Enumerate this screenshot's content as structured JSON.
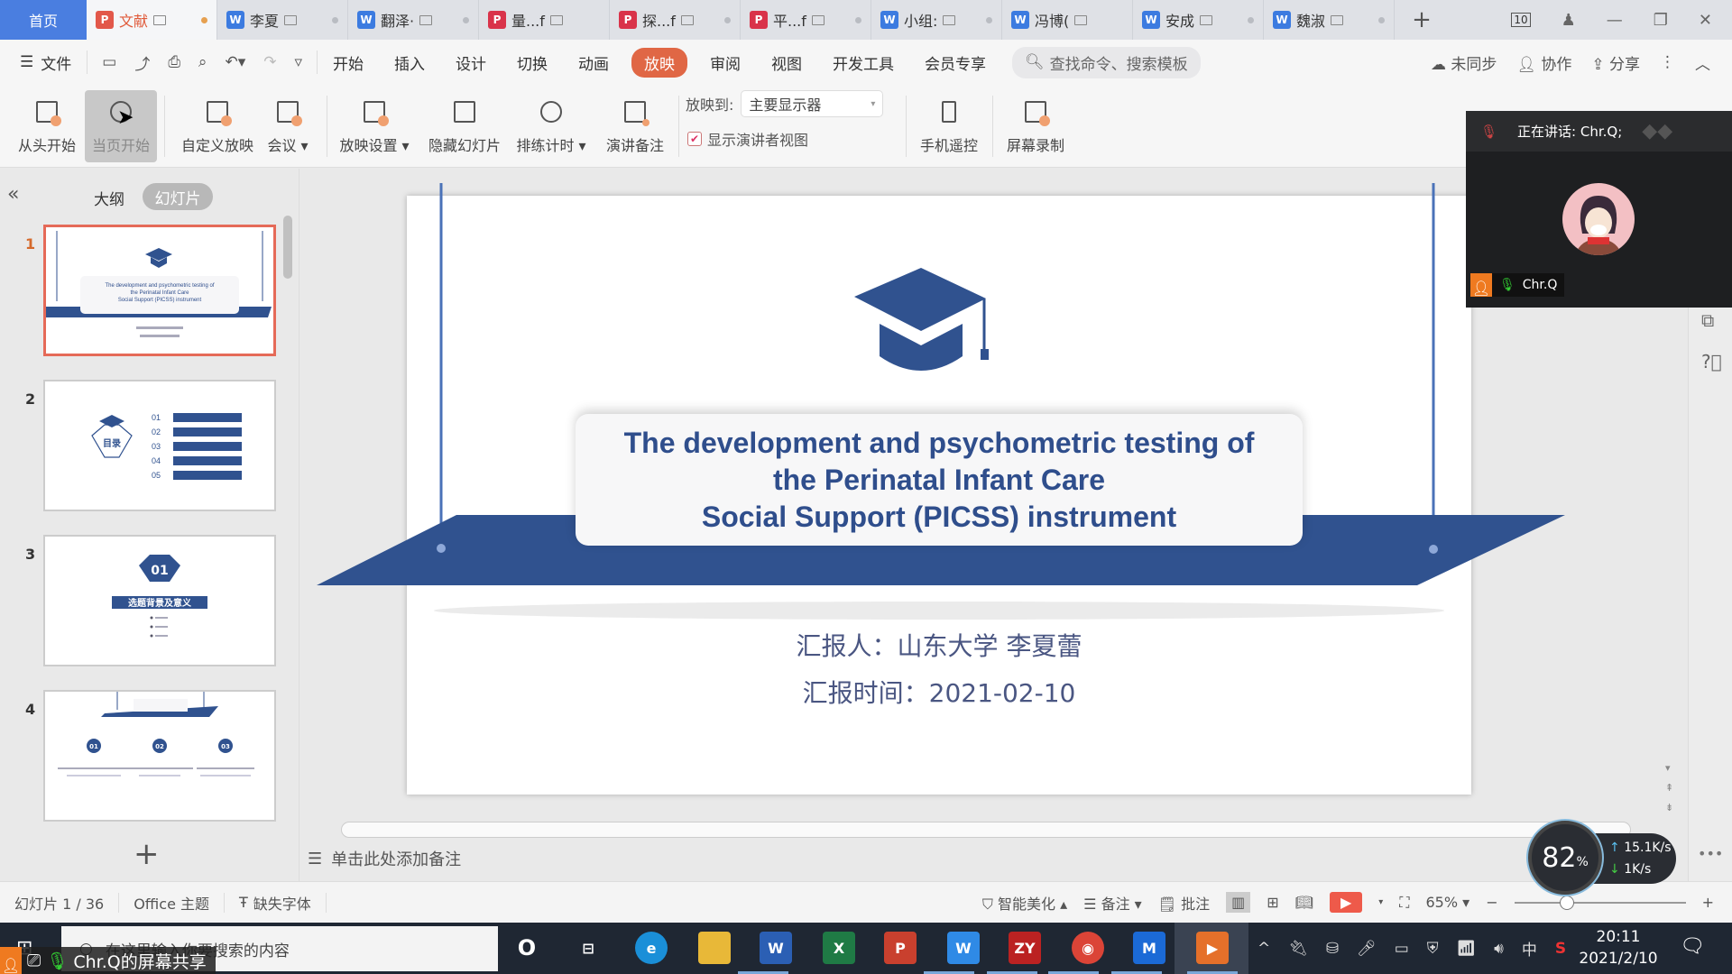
{
  "tabbar": {
    "home": "首页",
    "tabs": [
      {
        "label": "文献",
        "type": "p",
        "active": true
      },
      {
        "label": "李夏",
        "type": "w"
      },
      {
        "label": "翻泽·",
        "type": "w"
      },
      {
        "label": "量...f",
        "type": "r"
      },
      {
        "label": "探...f",
        "type": "r"
      },
      {
        "label": "平...f",
        "type": "r"
      },
      {
        "label": "小组:",
        "type": "w"
      },
      {
        "label": "冯博(",
        "type": "w"
      },
      {
        "label": "安成",
        "type": "w"
      },
      {
        "label": "魏淑",
        "type": "w"
      }
    ],
    "add_tab": "+",
    "badge_box": "10",
    "minimize": "—",
    "restore": "❐",
    "close": "✕"
  },
  "menubar": {
    "file": "文件",
    "items": [
      "开始",
      "插入",
      "设计",
      "切换",
      "动画",
      "放映",
      "审阅",
      "视图",
      "开发工具",
      "会员专享"
    ],
    "active": "放映",
    "search_placeholder": "查找命令、搜索模板",
    "right": {
      "sync": "未同步",
      "collab": "协作",
      "share": "分享"
    }
  },
  "ribbon": {
    "buttons": [
      {
        "label": "从头开始"
      },
      {
        "label": "当页开始"
      },
      {
        "label": "自定义放映"
      },
      {
        "label": "会议 ▾"
      },
      {
        "label": "放映设置 ▾"
      },
      {
        "label": "隐藏幻灯片"
      },
      {
        "label": "排练计时 ▾"
      },
      {
        "label": "演讲备注"
      },
      {
        "label": "手机遥控"
      },
      {
        "label": "屏幕录制"
      }
    ],
    "cast_to_label": "放映到:",
    "cast_to_value": "主要显示器",
    "presenter_view_label": "显示演讲者视图",
    "presenter_view_checked": true
  },
  "leftpanel": {
    "outline_tab": "大纲",
    "slides_tab": "幻灯片",
    "thumbnails": [
      {
        "num": "1",
        "selected": true
      },
      {
        "num": "2"
      },
      {
        "num": "3"
      },
      {
        "num": "4"
      }
    ],
    "thumb2": {
      "title": "目录",
      "items": [
        "01",
        "02",
        "03",
        "04",
        "05"
      ]
    },
    "thumb3": {
      "num": "01",
      "heading": "选题背景及意义"
    },
    "thumb4": {
      "items": [
        "01",
        "02",
        "03"
      ]
    },
    "add_slide": "+"
  },
  "slide": {
    "title_lines": [
      "The development and psychometric testing of",
      "the Perinatal Infant Care",
      "Social Support (PICSS) instrument"
    ],
    "reporter": "汇报人：山东大学 李夏蕾",
    "report_time": "汇报时间：2021-02-10",
    "colors": {
      "primary": "#30528f"
    }
  },
  "notes_placeholder": "单击此处添加备注",
  "statusbar": {
    "slide_counter": "幻灯片 1 / 36",
    "theme": "Office 主题",
    "missing_fonts": "缺失字体",
    "beautify": "智能美化 ▴",
    "notes": "备注 ▾",
    "comments": "批注",
    "zoom": "65% ▾",
    "zoom_minus": "−",
    "zoom_plus": "+",
    "zoom_level_percent": 65
  },
  "meeting": {
    "speaking": "正在讲话: Chr.Q;",
    "participant": "Chr.Q"
  },
  "share_banner": "Chr.Q的屏幕共享",
  "netmeter": {
    "percent": "82",
    "percent_sign": "%",
    "up": "15.1K/s",
    "down": "1K/s"
  },
  "taskbar": {
    "search_placeholder": "在这里输入你要搜索的内容",
    "apps": [
      "O",
      "⊟",
      "e",
      "📁",
      "W",
      "X",
      "P",
      "W",
      "ZY",
      "◉",
      "M",
      "▶"
    ],
    "ime": "中",
    "time": "20:11",
    "date": "2021/2/10"
  }
}
